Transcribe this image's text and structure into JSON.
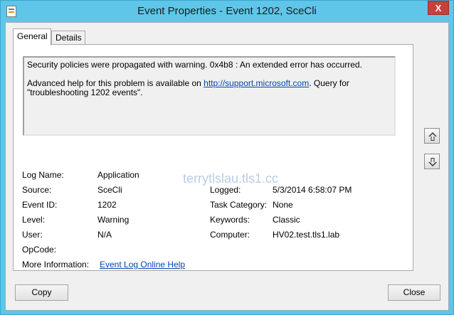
{
  "window": {
    "title": "Event Properties - Event 1202, SceCli",
    "close_glyph": "X"
  },
  "tabs": [
    {
      "label": "General"
    },
    {
      "label": "Details"
    }
  ],
  "description": {
    "line1": "Security policies were propagated with warning. 0x4b8 : An extended error has occurred.",
    "help_prefix": "Advanced help for this problem is available on ",
    "help_link": "http://support.microsoft.com",
    "help_suffix": ". Query for",
    "help_line2": "\"troubleshooting 1202 events\"."
  },
  "fields": {
    "log_name_label": "Log Name:",
    "log_name": "Application",
    "source_label": "Source:",
    "source": "SceCli",
    "logged_label": "Logged:",
    "logged": "5/3/2014 6:58:07 PM",
    "event_id_label": "Event ID:",
    "event_id": "1202",
    "task_category_label": "Task Category:",
    "task_category": "None",
    "level_label": "Level:",
    "level": "Warning",
    "keywords_label": "Keywords:",
    "keywords": "Classic",
    "user_label": "User:",
    "user": "N/A",
    "computer_label": "Computer:",
    "computer": "HV02.test.tls1.lab",
    "opcode_label": "OpCode:",
    "opcode": "",
    "more_info_label": "More Information:",
    "more_info_link": "Event Log Online Help"
  },
  "watermark": "terrytlslau.tls1.cc",
  "buttons": {
    "copy": "Copy",
    "close": "Close"
  },
  "colors": {
    "titlebar": "#5fc6ea",
    "close_button": "#c7403b",
    "link": "#0645ad"
  }
}
